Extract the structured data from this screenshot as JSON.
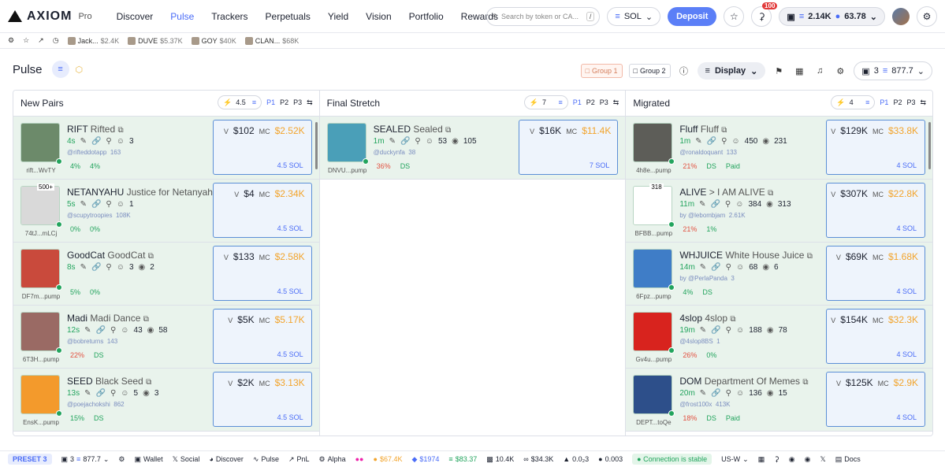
{
  "brand": {
    "name": "AXIOM",
    "sub": "Pro"
  },
  "nav": [
    "Discover",
    "Pulse",
    "Trackers",
    "Perpetuals",
    "Yield",
    "Vision",
    "Portfolio",
    "Rewards"
  ],
  "search": {
    "placeholder": "Search by token or CA...",
    "shortcut": "/"
  },
  "chain": "SOL",
  "deposit": "Deposit",
  "notifications": "100",
  "wallet": {
    "balance": "2.14K",
    "sol": "63.78"
  },
  "watchlist": [
    {
      "name": "Jack...",
      "value": "$2.4K"
    },
    {
      "name": "DUVE",
      "value": "$5.37K"
    },
    {
      "name": "GOY",
      "value": "$40K"
    },
    {
      "name": "CLAN...",
      "value": "$68K"
    }
  ],
  "page": {
    "title": "Pulse",
    "group1": "Group 1",
    "group2": "Group 2",
    "display": "Display",
    "count": "3",
    "value": "877.7"
  },
  "columns": [
    {
      "title": "New Pairs",
      "bolt": "4.5",
      "p": [
        "P1",
        "P2",
        "P3"
      ],
      "cards": [
        {
          "ticker": "RIFT",
          "full": "Rifted",
          "age": "4s",
          "holders": "3",
          "handle": "@rifteddotapp",
          "followers": "163",
          "p1": "4%",
          "p2": "4%",
          "v": "$102",
          "mc": "$2.52K",
          "sol": "4.5 SOL",
          "label": "rift...WvTY",
          "color": "#6c8a6a"
        },
        {
          "ticker": "NETANYAHU",
          "full": "Justice for Netanyahu",
          "age": "5s",
          "holders": "1",
          "handle": "@scupytroopies",
          "followers": "108K",
          "p1": "0%",
          "p2": "0%",
          "v": "$4",
          "mc": "$2.34K",
          "sol": "4.5 SOL",
          "label": "74tJ...mLCj",
          "color": "#d9d9d9",
          "tag": "500+"
        },
        {
          "ticker": "GoodCat",
          "full": "GoodCat",
          "age": "8s",
          "holders": "3",
          "views": "2",
          "handle": "",
          "followers": "",
          "p1": "5%",
          "p2": "0%",
          "v": "$133",
          "mc": "$2.58K",
          "sol": "4.5 SOL",
          "label": "DF7m...pump",
          "color": "#c94a3c"
        },
        {
          "ticker": "Madi",
          "full": "Madi Dance",
          "age": "12s",
          "holders": "43",
          "views": "58",
          "handle": "@bobreturns",
          "followers": "143",
          "p1": "22%",
          "p2": "DS",
          "v": "$5K",
          "mc": "$5.17K",
          "sol": "4.5 SOL",
          "label": "6T3H...pump",
          "color": "#9a6a64"
        },
        {
          "ticker": "SEED",
          "full": "Black Seed",
          "age": "13s",
          "holders": "5",
          "views": "3",
          "handle": "@poejachokshi",
          "followers": "862",
          "p1": "15%",
          "p2": "DS",
          "v": "$2K",
          "mc": "$3.13K",
          "sol": "4.5 SOL",
          "label": "EnsK...pump",
          "color": "#f39a2c"
        }
      ]
    },
    {
      "title": "Final Stretch",
      "bolt": "7",
      "p": [
        "P1",
        "P2",
        "P3"
      ],
      "cards": [
        {
          "ticker": "SEALED",
          "full": "Sealed",
          "age": "1m",
          "holders": "53",
          "views": "105",
          "handle": "@duckynfa",
          "followers": "38",
          "p1": "36%",
          "p2": "DS",
          "v": "$16K",
          "mc": "$11.4K",
          "sol": "7 SOL",
          "label": "DNVU...pump",
          "color": "#4a9fb8"
        }
      ]
    },
    {
      "title": "Migrated",
      "bolt": "4",
      "p": [
        "P1",
        "P2",
        "P3"
      ],
      "cards": [
        {
          "ticker": "Fluff",
          "full": "Fluff",
          "age": "1m",
          "holders": "450",
          "views": "231",
          "handle": "@ronaldoquant",
          "followers": "133",
          "p1": "21%",
          "p2": "DS",
          "p3": "Paid",
          "v": "$129K",
          "mc": "$33.8K",
          "sol": "4 SOL",
          "label": "4h8e...pump",
          "color": "#5d5d58"
        },
        {
          "ticker": "ALIVE",
          "full": "> I AM ALIVE",
          "age": "11m",
          "holders": "384",
          "views": "313",
          "handle": "by @lebombjam",
          "followers": "2.61K",
          "p1": "21%",
          "p2": "1%",
          "v": "$307K",
          "mc": "$22.8K",
          "sol": "4 SOL",
          "label": "BFBB...pump",
          "color": "#ffffff",
          "tag": "318"
        },
        {
          "ticker": "WHJUICE",
          "full": "White House Juice",
          "age": "14m",
          "holders": "68",
          "views": "6",
          "handle": "by @PerlaPanda",
          "followers": "3",
          "p1": "4%",
          "p2": "DS",
          "v": "$69K",
          "mc": "$1.68K",
          "sol": "4 SOL",
          "label": "6Fpz...pump",
          "color": "#3f7dc7"
        },
        {
          "ticker": "4slop",
          "full": "4slop",
          "age": "19m",
          "holders": "188",
          "views": "78",
          "handle": "@4slop8BS",
          "followers": "1",
          "p1": "26%",
          "p2": "0%",
          "v": "$154K",
          "mc": "$32.3K",
          "sol": "4 SOL",
          "label": "Gv4u...pump",
          "color": "#d8231e"
        },
        {
          "ticker": "DOM",
          "full": "Department Of Memes",
          "age": "20m",
          "holders": "136",
          "views": "15",
          "handle": "@frost100x",
          "followers": "413K",
          "p1": "18%",
          "p2": "DS",
          "p3": "Paid",
          "v": "$125K",
          "mc": "$2.9K",
          "sol": "4 SOL",
          "label": "DEPT...toQe",
          "color": "#2d4f8a"
        }
      ]
    }
  ],
  "bottom": {
    "preset": "PRESET 3",
    "count": "3",
    "value": "877.7",
    "items": [
      "Wallet",
      "Social",
      "Discover",
      "Pulse",
      "PnL",
      "Alpha"
    ],
    "btc": "$67.4K",
    "eth": "$1974",
    "sol": "$83.37",
    "fee1": "10.4K",
    "fee2": "$34.3K",
    "fee3": "0.0₂3",
    "fee4": "0.003",
    "conn": "Connection is stable",
    "region": "US-W",
    "docs": "Docs"
  }
}
